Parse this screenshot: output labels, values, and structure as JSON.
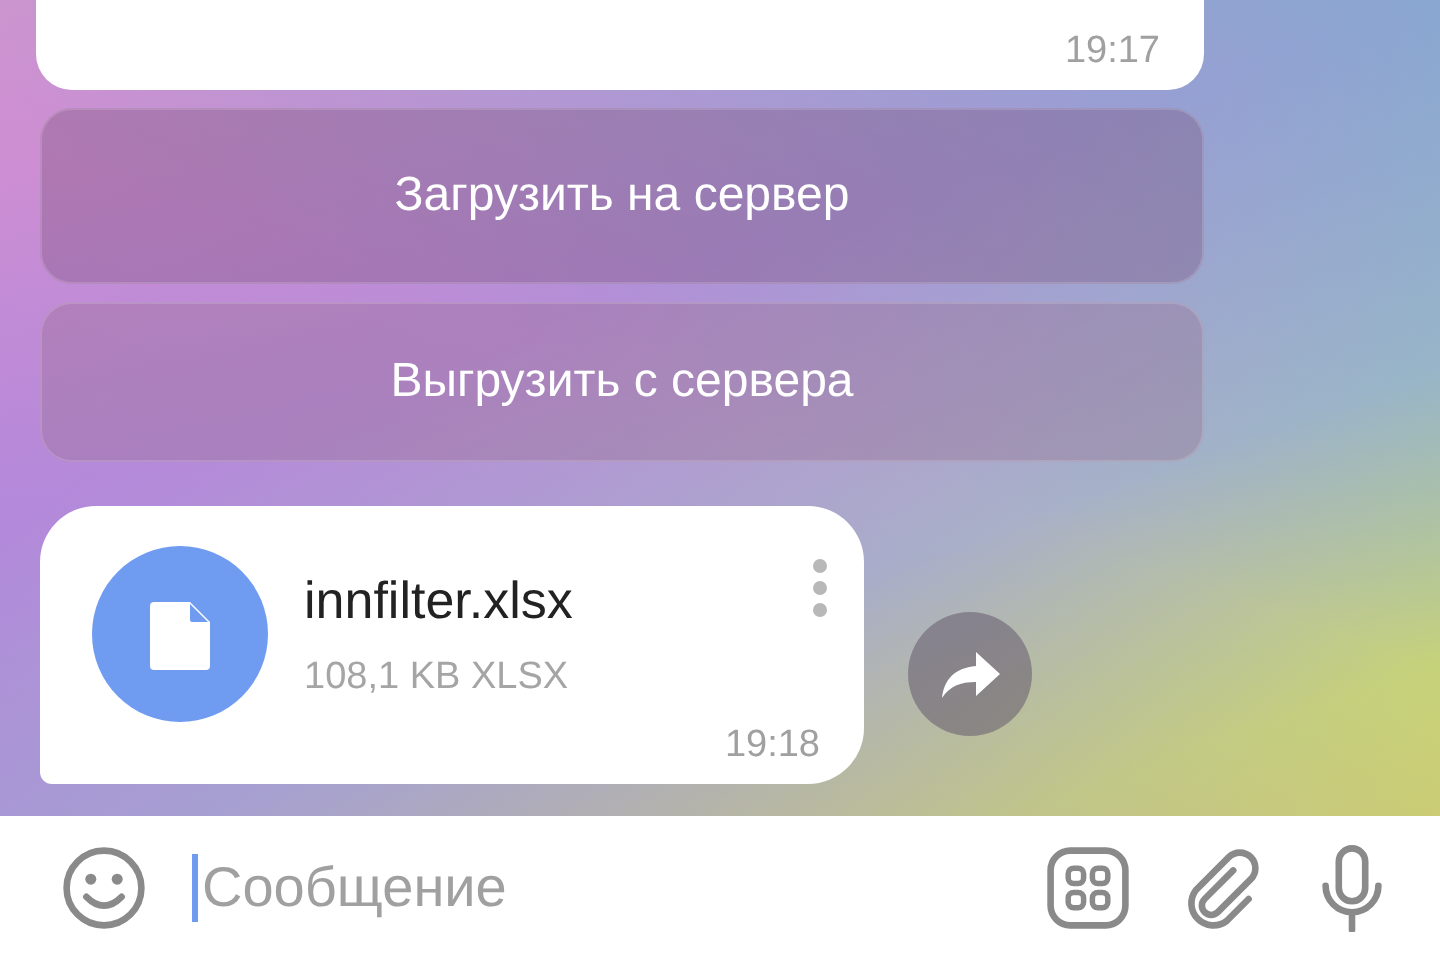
{
  "messages": [
    {
      "kind": "text",
      "time": "19:17"
    }
  ],
  "bot_buttons": [
    "Загрузить на сервер",
    "Выгрузить с сервера"
  ],
  "file": {
    "name": "innfilter.xlsx",
    "info": "108,1 KB XLSX",
    "time": "19:18"
  },
  "composer": {
    "placeholder": "Сообщение"
  }
}
